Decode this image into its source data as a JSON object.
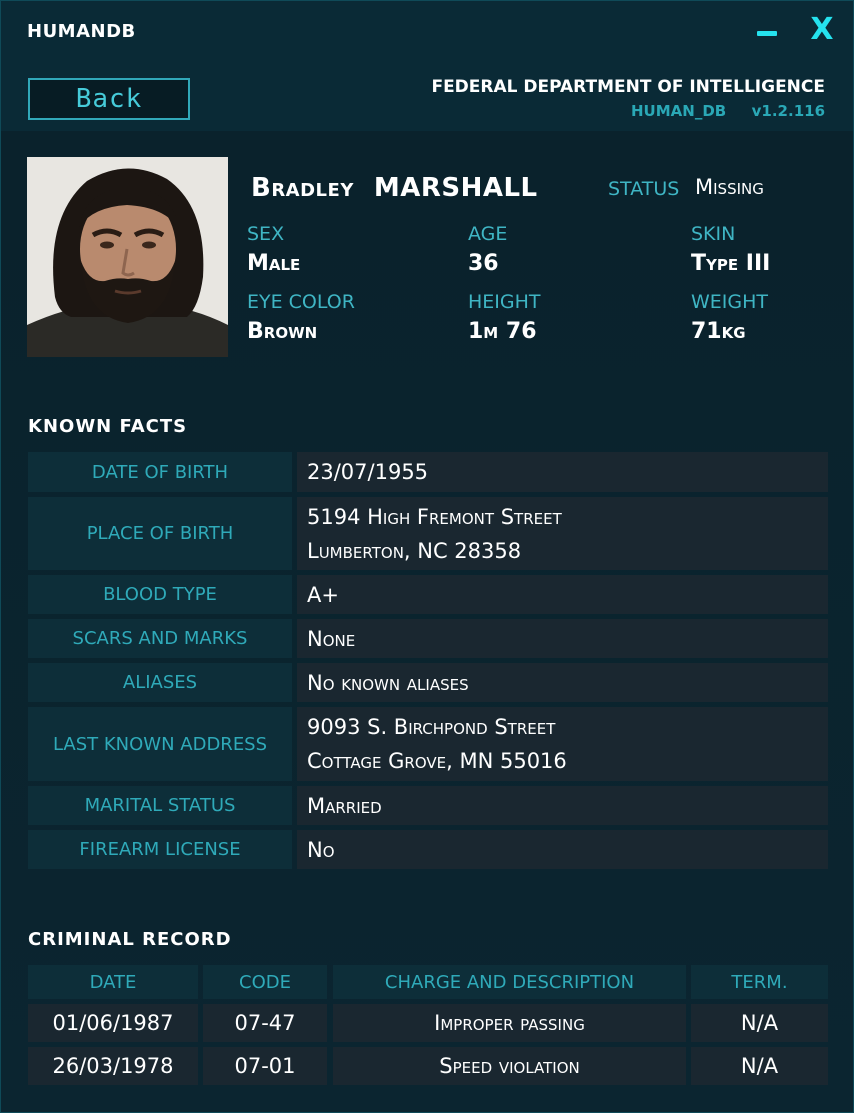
{
  "window": {
    "title": "HUMANDB",
    "minimize_glyph": "–",
    "close_glyph": "X"
  },
  "header": {
    "back_label": "Back",
    "org_name": "FEDERAL DEPARTMENT OF INTELLIGENCE",
    "db_name": "HUMAN_DB",
    "version": "v1.2.116"
  },
  "profile": {
    "first_name": "Bradley",
    "last_name": "MARSHALL",
    "status_label": "STATUS",
    "status_value": "Missing",
    "attributes": [
      {
        "label": "SEX",
        "value": "Male"
      },
      {
        "label": "AGE",
        "value": "36"
      },
      {
        "label": "SKIN",
        "value": "Type III"
      },
      {
        "label": "EYE COLOR",
        "value": "Brown"
      },
      {
        "label": "HEIGHT",
        "value": "1m 76"
      },
      {
        "label": "WEIGHT",
        "value": "71kg"
      }
    ]
  },
  "known_facts": {
    "title": "KNOWN  FACTS",
    "rows": [
      {
        "label": "DATE OF BIRTH",
        "lines": [
          "23/07/1955"
        ]
      },
      {
        "label": "PLACE OF BIRTH",
        "lines": [
          "5194 High Fremont Street",
          "Lumberton, NC 28358"
        ]
      },
      {
        "label": "BLOOD TYPE",
        "lines": [
          "A+"
        ]
      },
      {
        "label": "SCARS AND MARKS",
        "lines": [
          "None"
        ]
      },
      {
        "label": "ALIASES",
        "lines": [
          "No known aliases"
        ]
      },
      {
        "label": "LAST KNOWN ADDRESS",
        "lines": [
          "9093 S. Birchpond Street",
          "Cottage Grove, MN 55016"
        ]
      },
      {
        "label": "MARITAL STATUS",
        "lines": [
          "Married"
        ]
      },
      {
        "label": "FIREARM LICENSE",
        "lines": [
          "No"
        ]
      }
    ]
  },
  "criminal_record": {
    "title": "CRIMINAL  RECORD",
    "columns": [
      "DATE",
      "CODE",
      "CHARGE AND DESCRIPTION",
      "TERM."
    ],
    "rows": [
      [
        "01/06/1987",
        "07-47",
        "Improper passing",
        "N/A"
      ],
      [
        "26/03/1978",
        "07-01",
        "Speed violation",
        "N/A"
      ]
    ]
  }
}
